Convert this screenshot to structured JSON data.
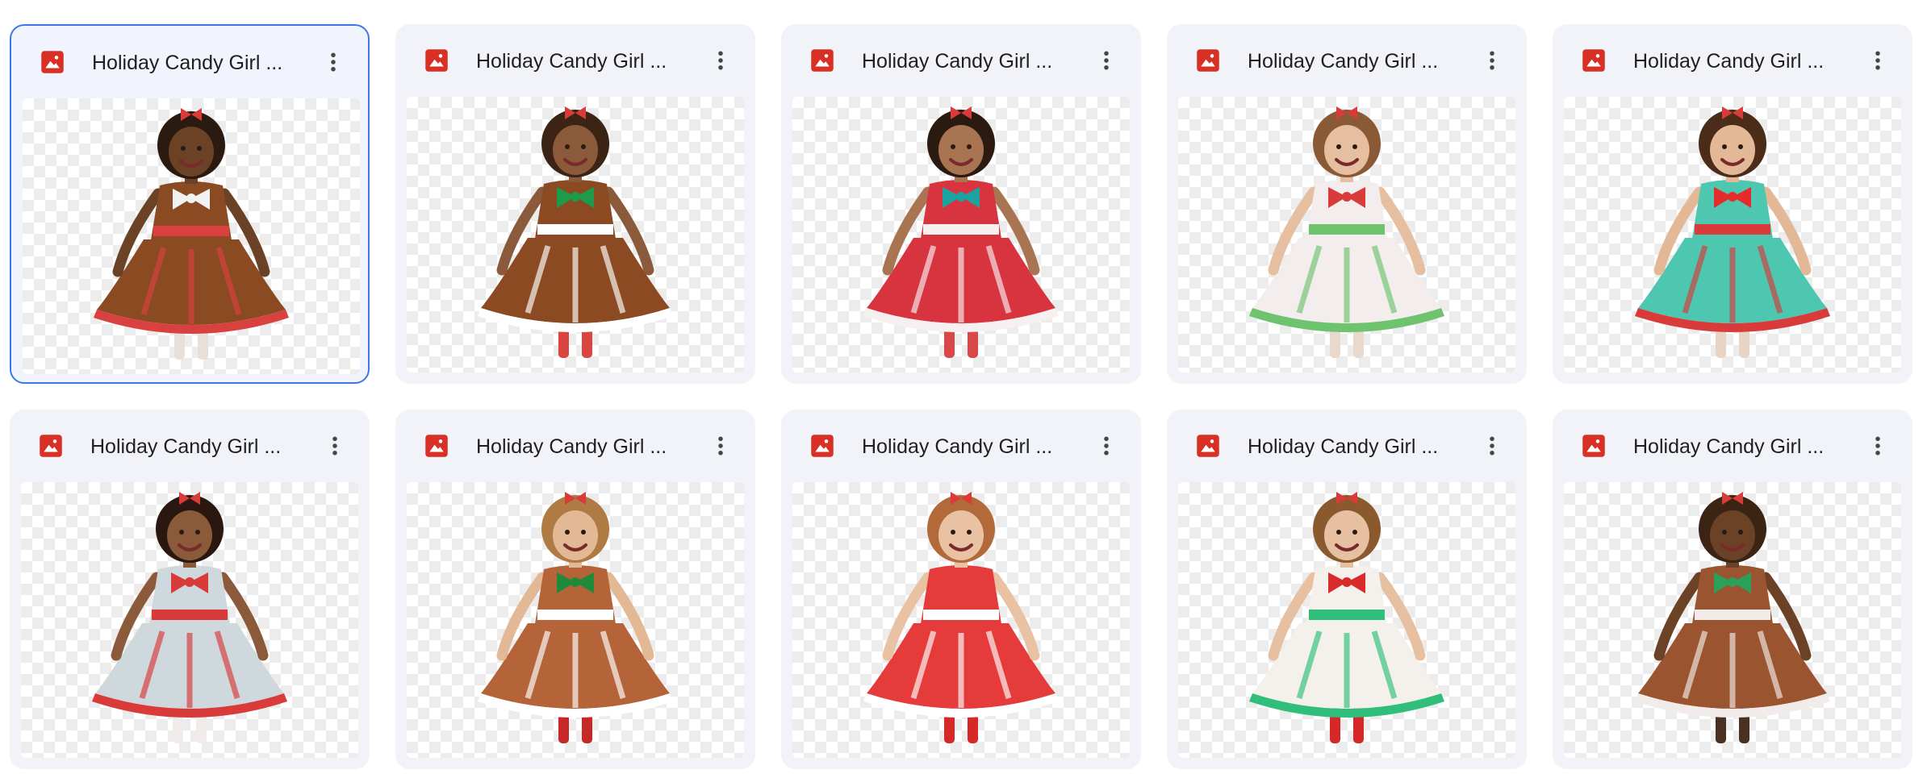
{
  "files": [
    {
      "name": "Holiday Candy Girl ...",
      "type_icon": "image-file-icon",
      "selected": true,
      "skin": "#6b4226",
      "hair": "#2a1a10",
      "dress": "#8a4a22",
      "trim": "#d94141",
      "bow": "#f2f2f2",
      "legs": "#e8e0d8"
    },
    {
      "name": "Holiday Candy Girl ...",
      "type_icon": "image-file-icon",
      "selected": false,
      "skin": "#8a5a3a",
      "hair": "#3b2414",
      "dress": "#8b4a22",
      "trim": "#ffffff",
      "bow": "#1f9a4a",
      "legs": "#d9463f"
    },
    {
      "name": "Holiday Candy Girl ...",
      "type_icon": "image-file-icon",
      "selected": false,
      "skin": "#a87452",
      "hair": "#2b1a10",
      "dress": "#d8343f",
      "trim": "#f7f0f0",
      "bow": "#1ba3a0",
      "legs": "#d84848"
    },
    {
      "name": "Holiday Candy Girl ...",
      "type_icon": "image-file-icon",
      "selected": false,
      "skin": "#e5bf9f",
      "hair": "#8a5a36",
      "dress": "#f3eded",
      "trim": "#6fc36f",
      "bow": "#d93a3a",
      "legs": "#e9d8cc"
    },
    {
      "name": "Holiday Candy Girl ...",
      "type_icon": "image-file-icon",
      "selected": false,
      "skin": "#e2b896",
      "hair": "#4a2c18",
      "dress": "#4ec7b0",
      "trim": "#d93a3a",
      "bow": "#e52b2b",
      "legs": "#e8d4c4"
    },
    {
      "name": "Holiday Candy Girl ...",
      "type_icon": "image-file-icon",
      "selected": false,
      "skin": "#8a5a3a",
      "hair": "#2a1810",
      "dress": "#cfd8dc",
      "trim": "#d93a3a",
      "bow": "#d93a3a",
      "legs": "#f1ecea"
    },
    {
      "name": "Holiday Candy Girl ...",
      "type_icon": "image-file-icon",
      "selected": false,
      "skin": "#e3b894",
      "hair": "#b07a44",
      "dress": "#b5643a",
      "trim": "#ffffff",
      "bow": "#1f8a3a",
      "legs": "#c62828"
    },
    {
      "name": "Holiday Candy Girl ...",
      "type_icon": "image-file-icon",
      "selected": false,
      "skin": "#e8c2a2",
      "hair": "#b36a3a",
      "dress": "#e53b3b",
      "trim": "#ffffff",
      "bow": "#e53b3b",
      "legs": "#d62828"
    },
    {
      "name": "Holiday Candy Girl ...",
      "type_icon": "image-file-icon",
      "selected": false,
      "skin": "#e6c0a0",
      "hair": "#8a5a2e",
      "dress": "#f4f1ec",
      "trim": "#2fbf7a",
      "bow": "#d92b2b",
      "legs": "#d62828"
    },
    {
      "name": "Holiday Candy Girl ...",
      "type_icon": "image-file-icon",
      "selected": false,
      "skin": "#6b4226",
      "hair": "#3b2414",
      "dress": "#9a5530",
      "trim": "#f1ecea",
      "bow": "#2aa05a",
      "legs": "#4a3020"
    }
  ],
  "colors": {
    "icon_red": "#d93025",
    "accent_blue": "#3b78e7",
    "card_bg": "#f1f3f9",
    "text": "#1f1f1f",
    "kebab": "#444746"
  }
}
